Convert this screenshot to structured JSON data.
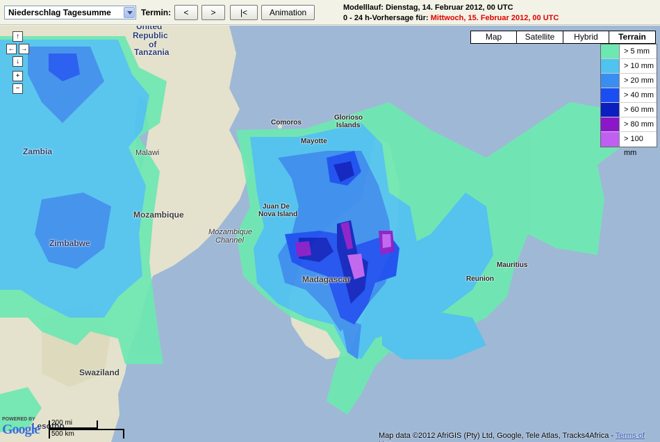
{
  "toolbar": {
    "product_select": "Niederschlag Tagesumme",
    "termin_label": "Termin:",
    "btn_prev": "<",
    "btn_next": ">",
    "btn_first": "|<",
    "btn_animation": "Animation",
    "model_run": "Modelllauf: Dienstag, 14. Februar 2012, 00 UTC",
    "forecast_prefix": "0 - 24 h-Vorhersage für: ",
    "forecast_date": "Mittwoch, 15. Februar 2012, 00 UTC"
  },
  "map_types": [
    {
      "label": "Map",
      "active": false
    },
    {
      "label": "Satellite",
      "active": false
    },
    {
      "label": "Hybrid",
      "active": false
    },
    {
      "label": "Terrain",
      "active": true
    }
  ],
  "legend": [
    {
      "label": "> 5 mm",
      "color": "#6ee8b2"
    },
    {
      "label": "> 10 mm",
      "color": "#4fc4f0"
    },
    {
      "label": "> 20 mm",
      "color": "#3a8ef0"
    },
    {
      "label": "> 40 mm",
      "color": "#1a4ef2"
    },
    {
      "label": "> 60 mm",
      "color": "#0b1fc0"
    },
    {
      "label": "> 80 mm",
      "color": "#8a18c8"
    },
    {
      "label": "> 100 mm",
      "color": "#c060f0"
    }
  ],
  "places": {
    "united_republic": "United",
    "republic": "Republic",
    "of": "of",
    "tanzania": "Tanzania",
    "zambia": "Zambia",
    "malawi": "Malawi",
    "mozambique": "Mozambique",
    "zimbabwe": "Zimbabwe",
    "swaziland": "Swaziland",
    "lesotho": "Lesotho",
    "comoros": "Comoros",
    "mayotte": "Mayotte",
    "glorioso": "Glorioso",
    "islands": "Islands",
    "juan_de": "Juan De",
    "nova_island": "Nova Island",
    "mozambique_channel_1": "Mozambique",
    "mozambique_channel_2": "Channel",
    "madagascar": "Madagascar",
    "mauritius": "Mauritius",
    "reunion": "Reunion"
  },
  "scale": {
    "miles": "200 mi",
    "km": "500 km"
  },
  "powered": {
    "small": "POWERED BY",
    "google": "Google"
  },
  "copyright": {
    "text": "Map data ©2012 AfriGIS (Pty) Ltd, Google, Tele Atlas, Tracks4Africa - ",
    "link": "Terms of Use"
  },
  "nav": {
    "up": "↑",
    "left": "←",
    "right": "→",
    "down": "↓",
    "zoom_in": "+",
    "zoom_out": "−"
  }
}
